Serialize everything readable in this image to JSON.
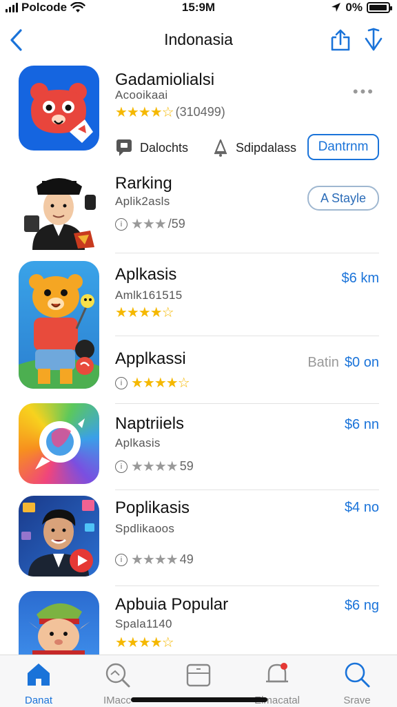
{
  "status_bar": {
    "carrier": "Polcode",
    "time": "15:9M",
    "battery": "0%",
    "battery_level": 0.95
  },
  "nav": {
    "title": "Indonasia"
  },
  "apps": [
    {
      "name": "Gadamiolialsi",
      "subtitle": "Acooikaai",
      "stars": "★★★★☆",
      "rating_count": "(310499)",
      "menu": "•••",
      "actions": [
        {
          "label": "Dalochts",
          "icon": "message-icon"
        },
        {
          "label": "Sdipdalass",
          "icon": "bell-icon"
        }
      ],
      "button": "Dantrnm"
    },
    {
      "name": "Rarking",
      "subtitle": "Aplik2asls",
      "stars": "★★★",
      "rating_count": "/59",
      "info": "i",
      "button": "A Stayle"
    },
    {
      "name": "Aplkasis",
      "subtitle": "Amlk161515",
      "stars": "★★★★☆",
      "price": "$6 km"
    },
    {
      "name": "Applkassi",
      "stars": "★★★★☆",
      "info": "i",
      "price_prefix": "Batin",
      "price": "$0 on"
    },
    {
      "name": "Naptriiels",
      "subtitle": "Aplkasis",
      "stars": "★★★★",
      "rating_count": "59",
      "info": "i",
      "price": "$6 nn"
    },
    {
      "name": "Poplikasis",
      "subtitle": "Spdlikaoos",
      "stars": "★★★★",
      "rating_count": "49",
      "info": "i",
      "price": "$4 no"
    },
    {
      "name": "Apbuia Popular",
      "subtitle": "Spala1140",
      "stars": "★★★★☆",
      "price": "$6 ng"
    }
  ],
  "tabs": [
    {
      "label": "Danat",
      "icon": "home-icon",
      "active": true
    },
    {
      "label": "IMacc",
      "icon": "search-zoom-icon"
    },
    {
      "label": "",
      "icon": "calendar-icon"
    },
    {
      "label": "Elmacatal",
      "icon": "notification-bell-icon"
    },
    {
      "label": "Srave",
      "icon": "search-icon"
    }
  ],
  "colors": {
    "accent": "#1a73d9",
    "star": "#f5b800",
    "divider": "#e2e2e2"
  }
}
